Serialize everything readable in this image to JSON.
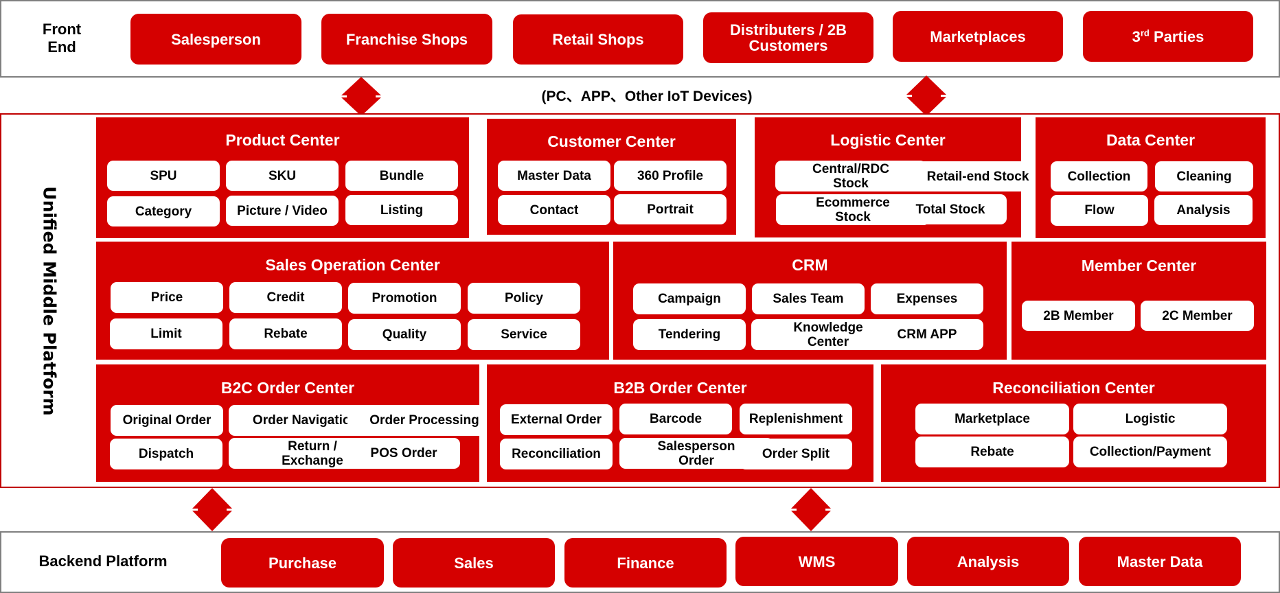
{
  "front_end": {
    "label": "Front End",
    "label_lines": [
      "Front",
      "End"
    ],
    "channels": [
      {
        "label": "Salesperson"
      },
      {
        "label": "Franchise Shops"
      },
      {
        "label": "Retail Shops"
      },
      {
        "label_lines": [
          "Distributers / 2B",
          "Customers"
        ],
        "label": "Distributers / 2B Customers"
      },
      {
        "label": "Marketplaces"
      },
      {
        "label_base": "3",
        "label_sup": "rd",
        "label_rest": " Parties",
        "label": "3rd Parties"
      }
    ]
  },
  "device_note": "(PC、APP、Other IoT Devices)",
  "middle_platform": {
    "label": "Unified Middle Platform",
    "centers": [
      {
        "title": "Product Center",
        "items": [
          "SPU",
          "SKU",
          "Bundle",
          "Category",
          "Picture / Video",
          "Listing"
        ]
      },
      {
        "title": "Customer Center",
        "items": [
          "Master Data",
          "360 Profile",
          "Contact",
          "Portrait"
        ]
      },
      {
        "title": "Logistic Center",
        "items": [
          "Central/RDC Stock",
          "Retail-end Stock",
          "Ecommerce Stock",
          "Total Stock"
        ]
      },
      {
        "title": "Data Center",
        "items": [
          "Collection",
          "Cleaning",
          "Flow",
          "Analysis"
        ]
      },
      {
        "title": "Sales Operation Center",
        "items": [
          "Price",
          "Credit",
          "Promotion",
          "Policy",
          "Limit",
          "Rebate",
          "Quality",
          "Service"
        ]
      },
      {
        "title": "CRM",
        "items": [
          "Campaign",
          "Sales Team",
          "Expenses",
          "Tendering",
          "Knowledge Center",
          "CRM APP"
        ]
      },
      {
        "title": "Member Center",
        "items": [
          "2B Member",
          "2C Member"
        ]
      },
      {
        "title": "B2C Order Center",
        "items": [
          "Original Order",
          "Order Navigation",
          "Order Processing",
          "Dispatch",
          "Return / Exchange",
          "POS Order"
        ]
      },
      {
        "title": "B2B Order Center",
        "items": [
          "External Order",
          "Barcode",
          "Replenishment",
          "Reconciliation",
          "Salesperson Order",
          "Order Split"
        ]
      },
      {
        "title": "Reconciliation Center",
        "items": [
          "Marketplace",
          "Logistic",
          "Rebate",
          "Collection/Payment"
        ]
      }
    ]
  },
  "backend": {
    "label": "Backend Platform",
    "systems": [
      {
        "label": "Purchase"
      },
      {
        "label": "Sales"
      },
      {
        "label": "Finance"
      },
      {
        "label": "WMS"
      },
      {
        "label": "Analysis"
      },
      {
        "label": "Master Data"
      }
    ]
  },
  "icons": {
    "connector": "double-arrow-vertical"
  },
  "colors": {
    "brand_red": "#d50000",
    "frame_gray": "#7f7f7f",
    "frame_red": "#c00000"
  }
}
